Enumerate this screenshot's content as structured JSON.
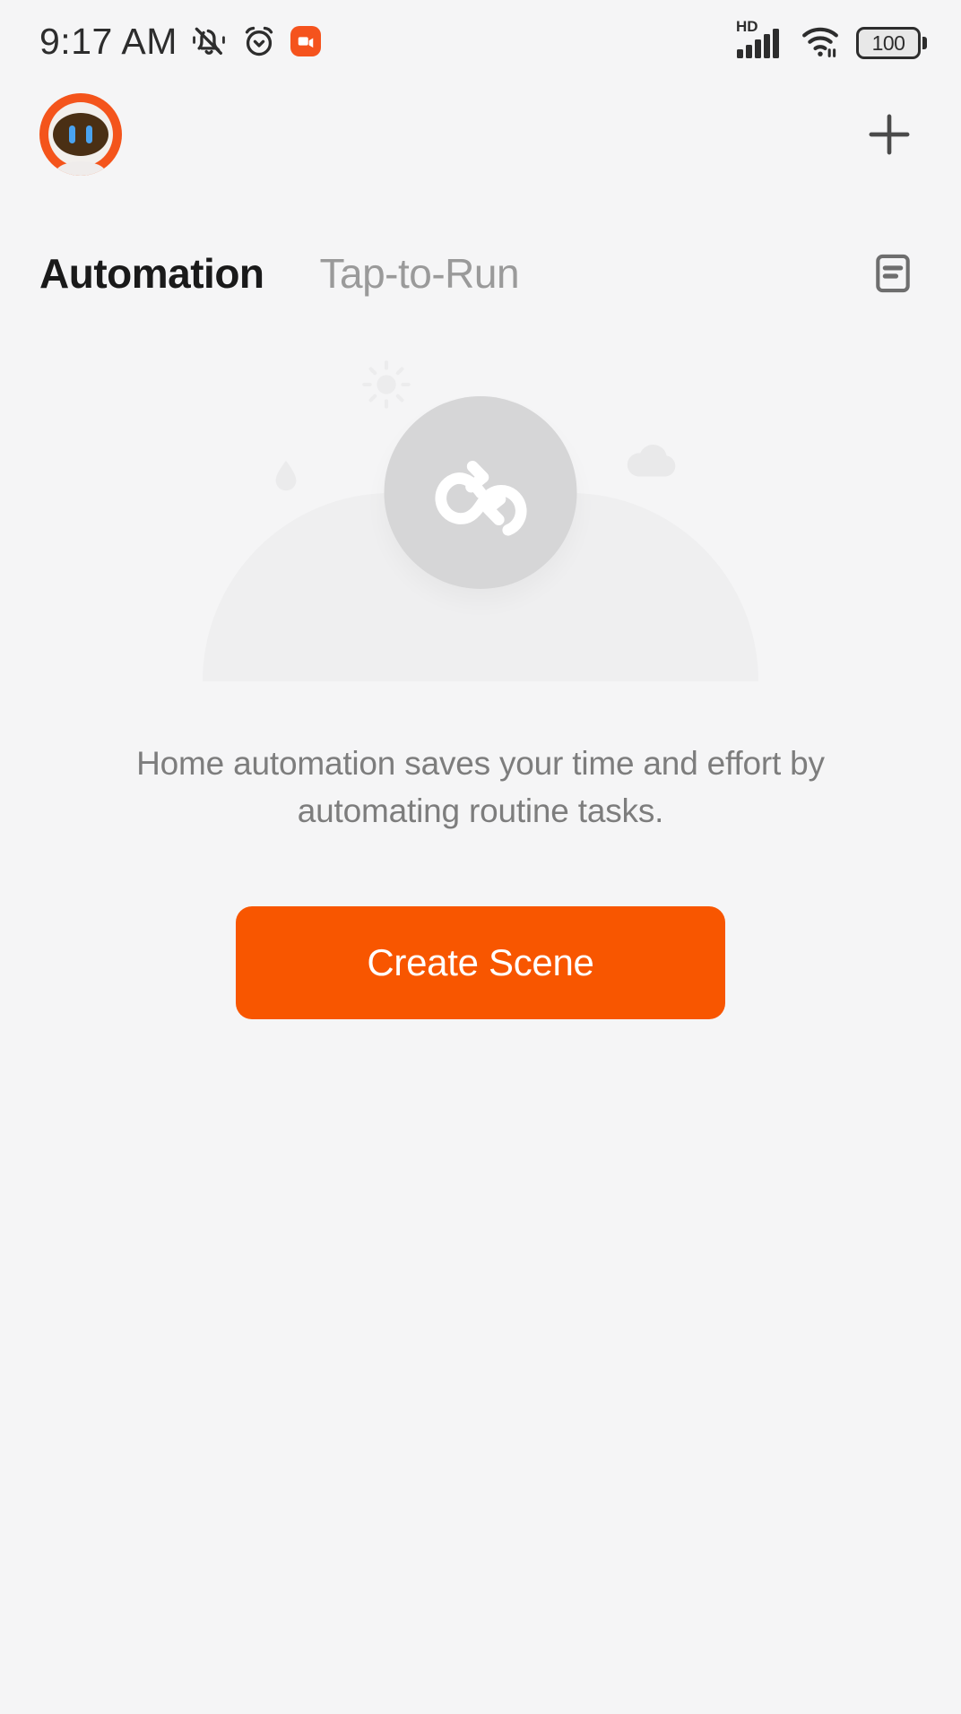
{
  "status_bar": {
    "time": "9:17 AM",
    "icons": {
      "silent": "bell-muted-icon",
      "alarm": "alarm-clock-icon",
      "recording": "screen-recording-icon",
      "network_label": "HD",
      "signal": "cellular-signal-icon",
      "wifi": "wifi-icon",
      "battery": "battery-icon"
    },
    "battery_level": "100"
  },
  "app_bar": {
    "avatar": "assistant-avatar",
    "add_label": "+"
  },
  "tabs": [
    {
      "label": "Automation",
      "active": true
    },
    {
      "label": "Tap-to-Run",
      "active": false
    }
  ],
  "log_button": "automation-log-icon",
  "empty_state": {
    "illustration": "automation-loop-illustration",
    "description": "Home automation saves your time and effort by automating routine tasks.",
    "cta_label": "Create Scene"
  },
  "colors": {
    "accent": "#f85600",
    "background": "#f5f5f6",
    "tab_active": "#1a1a1a",
    "tab_inactive": "#9a9a9a",
    "description_text": "#7d7d7d",
    "illustration_circle": "#d6d6d7",
    "recording_badge": "#f5531d"
  }
}
